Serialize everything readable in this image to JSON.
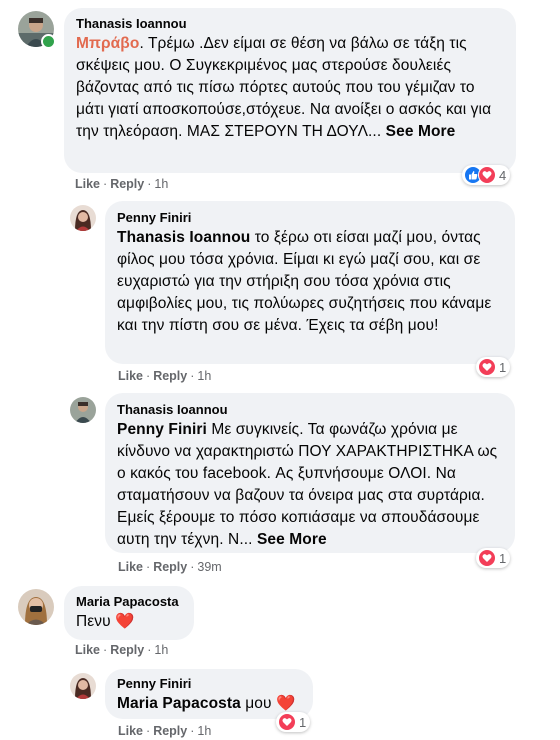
{
  "comments": [
    {
      "author": "Thanasis Ioannou",
      "lead": "Μπράβο",
      "text": ". Τρέμω .Δεν είμαι σε θέση να βάλω σε τάξη τις σκέψεις μου. Ο Συγκεκριμένος μας στερούσε δουλειές βάζοντας από τις πίσω πόρτες αυτούς που του γέμιζαν το μάτι γιατί αποσκοπούσε,στόχευε. Να ανοίξει ο ασκός και για την τηλεόραση. ΜΑΣ ΣΤΕΡΟΥΝ ΤΗ ΔΟΥΛ... ",
      "see_more": "See More",
      "like": "Like",
      "reply": "Reply",
      "time": "1h",
      "reaction_count": "4",
      "reactions": [
        "like-icon",
        "love-icon"
      ]
    },
    {
      "author": "Penny Finiri",
      "mention": "Thanasis Ioannou",
      "text": " το ξέρω οτι είσαι μαζί μου, όντας φίλος μου τόσα χρόνια. Είμαι κι εγώ μαζί σου, και σε ευχαριστώ για την στήριξη σου τόσα χρόνια στις αμφιβολίες μου, τις πολύωρες συζητήσεις που κάναμε και την πίστη σου σε μένα. Έχεις τα σέβη μου!",
      "like": "Like",
      "reply": "Reply",
      "time": "1h",
      "reaction_count": "1",
      "reactions": [
        "love-icon"
      ]
    },
    {
      "author": "Thanasis Ioannou",
      "mention": "Penny Finiri",
      "text": " Με συγκινείς. Τα φωνάζω χρόνια με κίνδυνο να χαρακτηριστώ ΠΟΥ ΧΑΡΑΚΤΗΡΙΣΤΗΚΑ ως ο κακός του facebook. Ας ξυπνήσουμε ΟΛΟΙ. Να σταματήσουν να βαζουν τα όνειρα μας στα συρτάρια. Εμείς ξέρουμε το πόσο κοπιάσαμε να σπουδάσουμε αυτη την τέχνη. Ν... ",
      "see_more": "See More",
      "like": "Like",
      "reply": "Reply",
      "time": "39m",
      "reaction_count": "1",
      "reactions": [
        "love-icon"
      ]
    },
    {
      "author": "Maria Papacosta",
      "text": "Πενυ ",
      "emoji": "❤️",
      "like": "Like",
      "reply": "Reply",
      "time": "1h"
    },
    {
      "author": "Penny Finiri",
      "mention": "Maria Papacosta",
      "text": " μου ",
      "emoji": "❤️",
      "like": "Like",
      "reply": "Reply",
      "time": "1h",
      "reaction_count": "1",
      "reactions": [
        "love-icon"
      ]
    }
  ],
  "colors": {
    "bubble": "#f0f2f5",
    "meta": "#65676b",
    "like_blue": "#1877f2",
    "love_red": "#f33e58",
    "bravo": "#e26a4f",
    "online": "#31a24c"
  }
}
